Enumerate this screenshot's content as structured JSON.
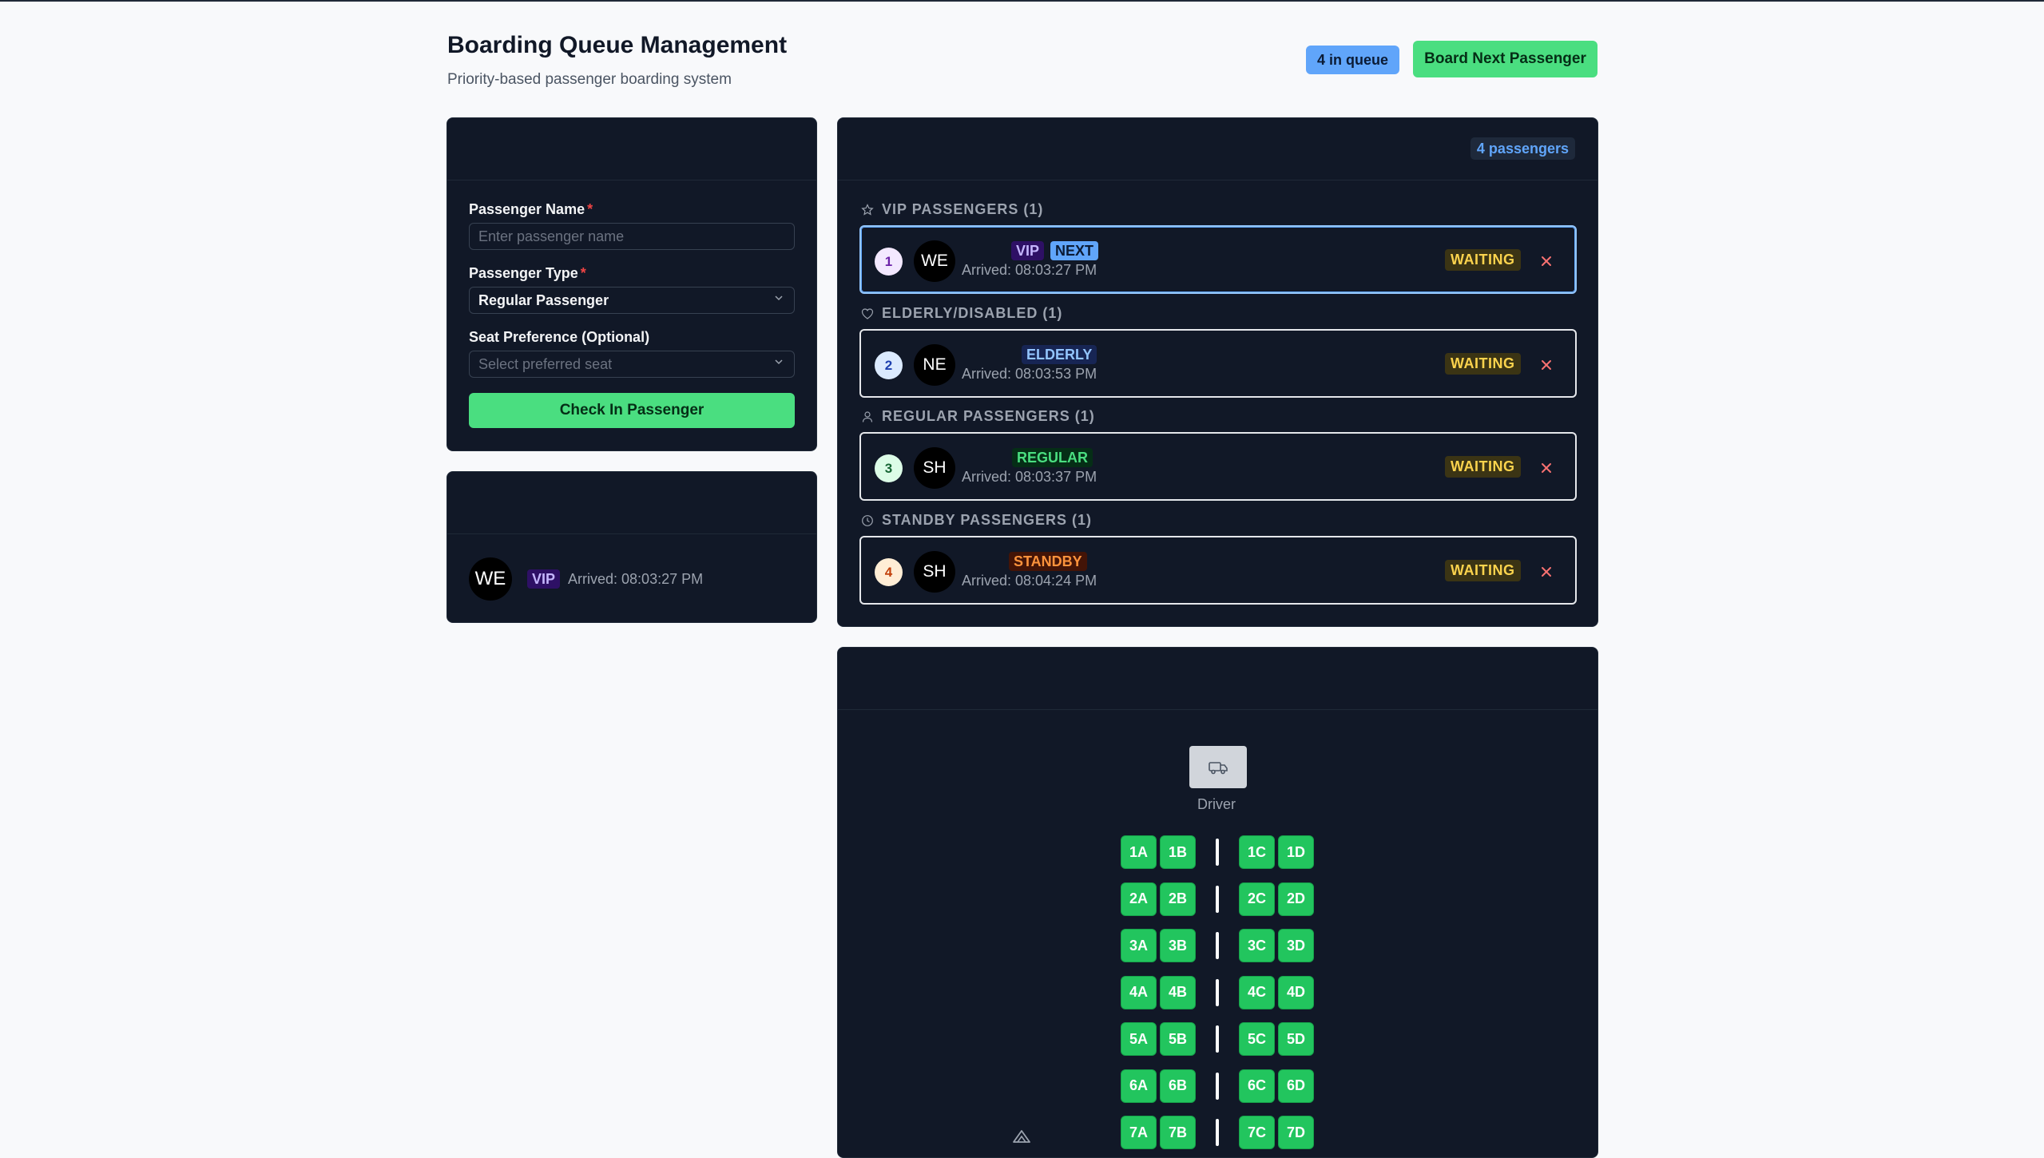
{
  "header": {
    "title": "Boarding Queue Management",
    "subtitle": "Priority-based passenger boarding system",
    "queue_badge": "4 in queue",
    "board_next_label": "Board Next Passenger"
  },
  "form": {
    "name_label": "Passenger Name",
    "name_placeholder": "Enter passenger name",
    "type_label": "Passenger Type",
    "type_value": "Regular Passenger",
    "seat_label": "Seat Preference (Optional)",
    "seat_placeholder": "Select preferred seat",
    "required_mark": "*",
    "submit_label": "Check In Passenger"
  },
  "next_passenger": {
    "initials": "WE",
    "type": "VIP",
    "arrived": "Arrived: 08:03:27 PM"
  },
  "queue": {
    "count_label": "4 passengers",
    "groups": [
      {
        "label": "VIP PASSENGERS (1)",
        "icon": "star-icon",
        "passenger": {
          "position": "1",
          "initials": "WE",
          "tags": [
            "VIP",
            "NEXT"
          ],
          "arrived": "Arrived: 08:03:27 PM",
          "status": "WAITING"
        }
      },
      {
        "label": "ELDERLY/DISABLED (1)",
        "icon": "heart-icon",
        "passenger": {
          "position": "2",
          "initials": "NE",
          "tags": [
            "ELDERLY"
          ],
          "arrived": "Arrived: 08:03:53 PM",
          "status": "WAITING"
        }
      },
      {
        "label": "REGULAR PASSENGERS (1)",
        "icon": "user-icon",
        "passenger": {
          "position": "3",
          "initials": "SH",
          "tags": [
            "REGULAR"
          ],
          "arrived": "Arrived: 08:03:37 PM",
          "status": "WAITING"
        }
      },
      {
        "label": "STANDBY PASSENGERS (1)",
        "icon": "clock-icon",
        "passenger": {
          "position": "4",
          "initials": "SH",
          "tags": [
            "STANDBY"
          ],
          "arrived": "Arrived: 08:04:24 PM",
          "status": "WAITING"
        }
      }
    ]
  },
  "seat_map": {
    "driver_label": "Driver",
    "driver_icon": "bus-icon",
    "rows": [
      [
        "1A",
        "1B",
        "1C",
        "1D"
      ],
      [
        "2A",
        "2B",
        "2C",
        "2D"
      ],
      [
        "3A",
        "3B",
        "3C",
        "3D"
      ],
      [
        "4A",
        "4B",
        "4C",
        "4D"
      ],
      [
        "5A",
        "5B",
        "5C",
        "5D"
      ],
      [
        "6A",
        "6B",
        "6C",
        "6D"
      ],
      [
        "7A",
        "7B",
        "7C",
        "7D"
      ]
    ],
    "seat_color": "#22c55e"
  },
  "colors": {
    "accent_green": "#4ade80",
    "accent_blue": "#60a5fa",
    "panel_bg": "#111827",
    "waiting_text": "#fcd34d"
  }
}
